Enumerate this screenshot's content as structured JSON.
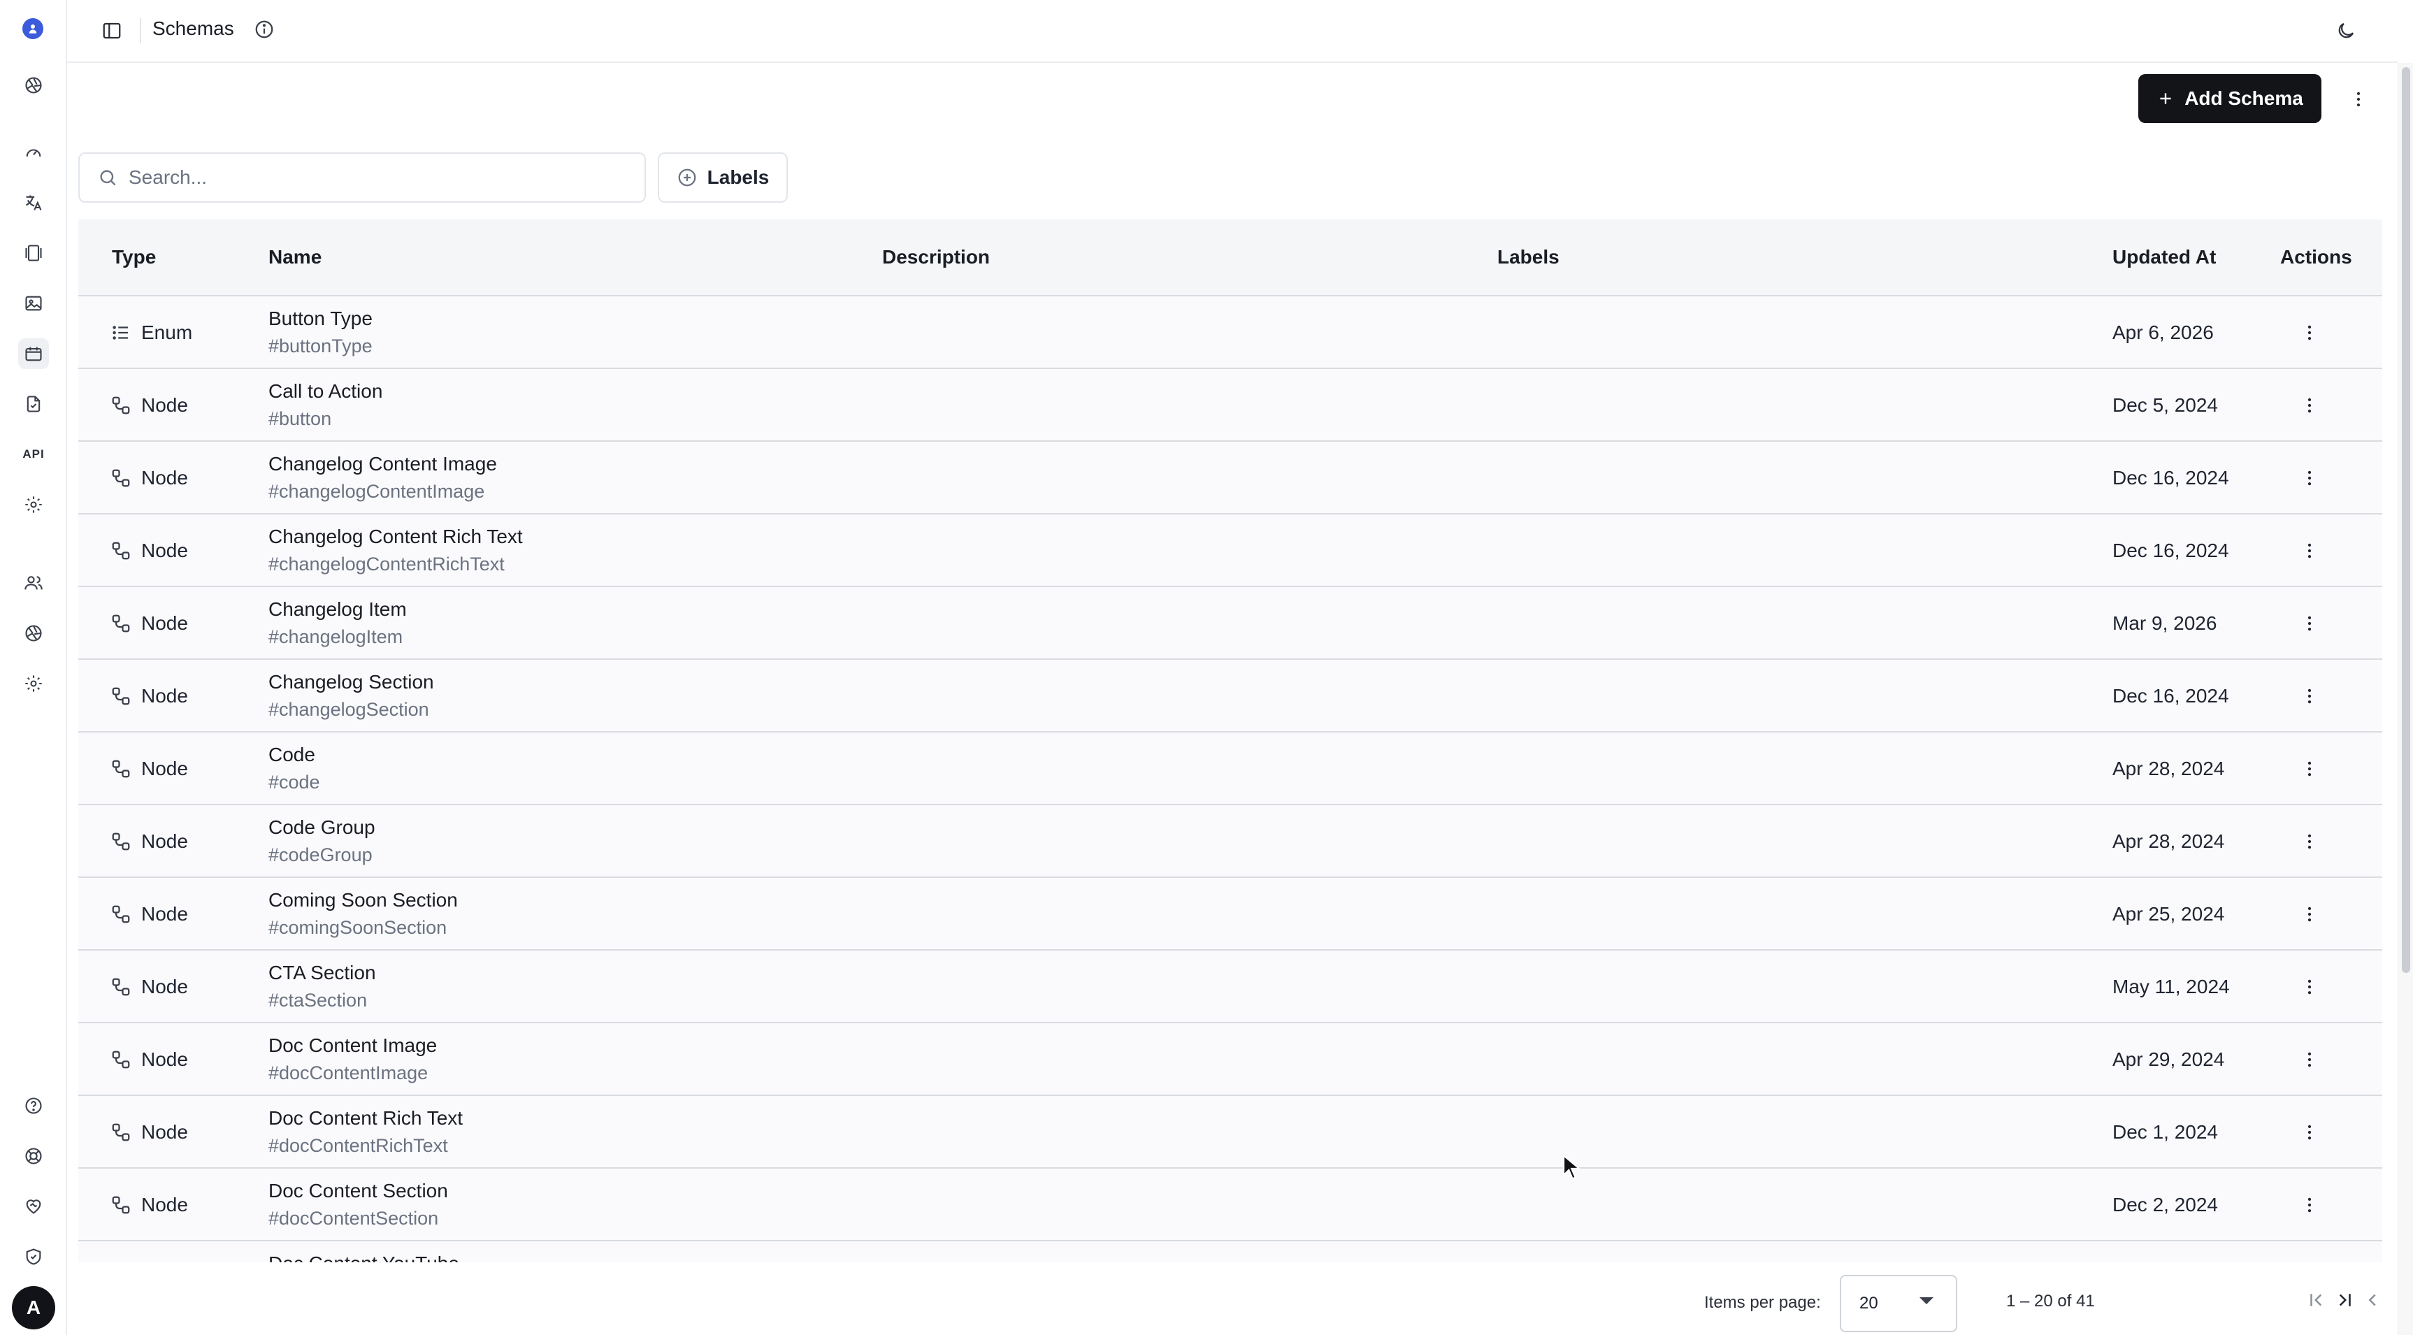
{
  "app": {
    "title": "Schemas",
    "theme_toggle_icon": "moon-icon",
    "avatar_initial": "A"
  },
  "rail": {
    "items": [
      {
        "name": "logo",
        "icon": "brand-icon"
      },
      {
        "name": "project",
        "icon": "aperture-icon"
      },
      {
        "name": "dashboard",
        "icon": "gauge-icon"
      },
      {
        "name": "localization",
        "icon": "translate-icon"
      },
      {
        "name": "content",
        "icon": "gallery-icon"
      },
      {
        "name": "assets",
        "icon": "image-icon"
      },
      {
        "name": "schemas",
        "icon": "calendar-icon",
        "active": true
      },
      {
        "name": "releases",
        "icon": "file-check-icon"
      },
      {
        "name": "api",
        "label": "API"
      },
      {
        "name": "settings",
        "icon": "gear-icon"
      },
      {
        "name": "team",
        "icon": "users-icon"
      },
      {
        "name": "spaces",
        "icon": "aperture-icon"
      },
      {
        "name": "space-settings",
        "icon": "gear-icon"
      },
      {
        "name": "help",
        "icon": "help-circle-icon"
      },
      {
        "name": "support",
        "icon": "lifebuoy-icon"
      },
      {
        "name": "sponsor",
        "icon": "heart-handshake-icon"
      },
      {
        "name": "security",
        "icon": "shield-check-icon"
      }
    ]
  },
  "toolbar": {
    "add_label": "Add Schema",
    "search_placeholder": "Search...",
    "labels_label": "Labels"
  },
  "table": {
    "columns": {
      "type": "Type",
      "name": "Name",
      "description": "Description",
      "labels": "Labels",
      "updated": "Updated At",
      "actions": "Actions"
    },
    "rows": [
      {
        "type": "Enum",
        "name": "Button Type",
        "slug": "#buttonType",
        "updated": "Apr 6, 2026"
      },
      {
        "type": "Node",
        "name": "Call to Action",
        "slug": "#button",
        "updated": "Dec 5, 2024"
      },
      {
        "type": "Node",
        "name": "Changelog Content Image",
        "slug": "#changelogContentImage",
        "updated": "Dec 16, 2024"
      },
      {
        "type": "Node",
        "name": "Changelog Content Rich Text",
        "slug": "#changelogContentRichText",
        "updated": "Dec 16, 2024"
      },
      {
        "type": "Node",
        "name": "Changelog Item",
        "slug": "#changelogItem",
        "updated": "Mar 9, 2026"
      },
      {
        "type": "Node",
        "name": "Changelog Section",
        "slug": "#changelogSection",
        "updated": "Dec 16, 2024"
      },
      {
        "type": "Node",
        "name": "Code",
        "slug": "#code",
        "updated": "Apr 28, 2024"
      },
      {
        "type": "Node",
        "name": "Code Group",
        "slug": "#codeGroup",
        "updated": "Apr 28, 2024"
      },
      {
        "type": "Node",
        "name": "Coming Soon Section",
        "slug": "#comingSoonSection",
        "updated": "Apr 25, 2024"
      },
      {
        "type": "Node",
        "name": "CTA Section",
        "slug": "#ctaSection",
        "updated": "May 11, 2024"
      },
      {
        "type": "Node",
        "name": "Doc Content Image",
        "slug": "#docContentImage",
        "updated": "Apr 29, 2024"
      },
      {
        "type": "Node",
        "name": "Doc Content Rich Text",
        "slug": "#docContentRichText",
        "updated": "Dec 1, 2024"
      },
      {
        "type": "Node",
        "name": "Doc Content Section",
        "slug": "#docContentSection",
        "updated": "Dec 2, 2024"
      },
      {
        "type": "Node",
        "name": "Doc Content YouTube",
        "slug": "",
        "updated": ""
      }
    ]
  },
  "pagination": {
    "items_per_page_label": "Items per page:",
    "items_per_page": "20",
    "range": "1 – 20 of 41"
  }
}
